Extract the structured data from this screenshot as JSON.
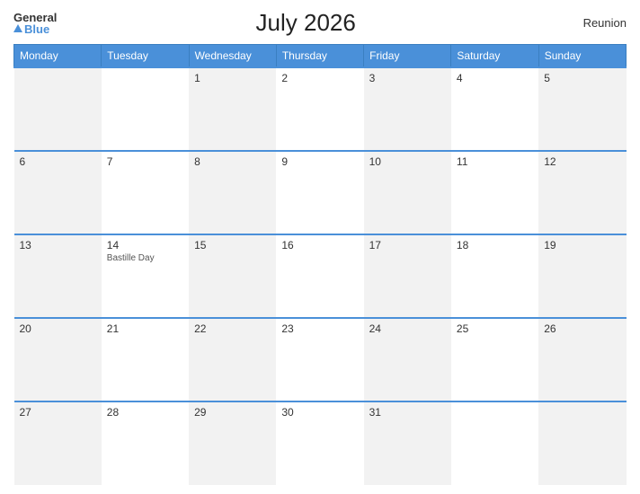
{
  "header": {
    "logo_general": "General",
    "logo_blue": "Blue",
    "title": "July 2026",
    "region": "Reunion"
  },
  "columns": [
    "Monday",
    "Tuesday",
    "Wednesday",
    "Thursday",
    "Friday",
    "Saturday",
    "Sunday"
  ],
  "weeks": [
    [
      {
        "num": "",
        "empty": true
      },
      {
        "num": "",
        "empty": true
      },
      {
        "num": "1",
        "holiday": ""
      },
      {
        "num": "2",
        "holiday": ""
      },
      {
        "num": "3",
        "holiday": ""
      },
      {
        "num": "4",
        "holiday": ""
      },
      {
        "num": "5",
        "holiday": ""
      }
    ],
    [
      {
        "num": "6",
        "holiday": ""
      },
      {
        "num": "7",
        "holiday": ""
      },
      {
        "num": "8",
        "holiday": ""
      },
      {
        "num": "9",
        "holiday": ""
      },
      {
        "num": "10",
        "holiday": ""
      },
      {
        "num": "11",
        "holiday": ""
      },
      {
        "num": "12",
        "holiday": ""
      }
    ],
    [
      {
        "num": "13",
        "holiday": ""
      },
      {
        "num": "14",
        "holiday": "Bastille Day"
      },
      {
        "num": "15",
        "holiday": ""
      },
      {
        "num": "16",
        "holiday": ""
      },
      {
        "num": "17",
        "holiday": ""
      },
      {
        "num": "18",
        "holiday": ""
      },
      {
        "num": "19",
        "holiday": ""
      }
    ],
    [
      {
        "num": "20",
        "holiday": ""
      },
      {
        "num": "21",
        "holiday": ""
      },
      {
        "num": "22",
        "holiday": ""
      },
      {
        "num": "23",
        "holiday": ""
      },
      {
        "num": "24",
        "holiday": ""
      },
      {
        "num": "25",
        "holiday": ""
      },
      {
        "num": "26",
        "holiday": ""
      }
    ],
    [
      {
        "num": "27",
        "holiday": ""
      },
      {
        "num": "28",
        "holiday": ""
      },
      {
        "num": "29",
        "holiday": ""
      },
      {
        "num": "30",
        "holiday": ""
      },
      {
        "num": "31",
        "holiday": ""
      },
      {
        "num": "",
        "empty": true
      },
      {
        "num": "",
        "empty": true
      }
    ]
  ],
  "colors": {
    "header_bg": "#4a90d9",
    "header_text": "#ffffff",
    "border_top": "#4a90d9"
  }
}
